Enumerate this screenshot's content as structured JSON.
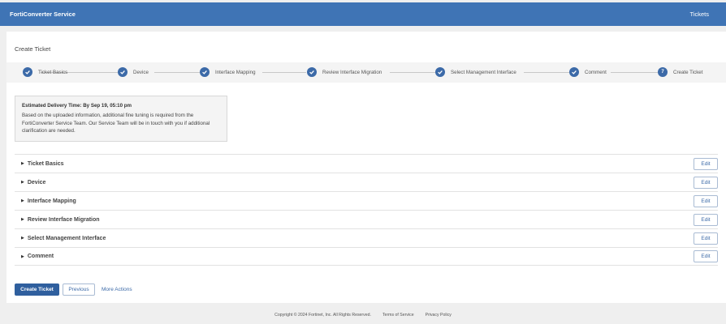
{
  "header": {
    "app_title": "FortiConverter Service",
    "nav_tickets": "Tickets"
  },
  "page": {
    "title": "Create Ticket"
  },
  "stepper": {
    "steps": [
      {
        "label": "Ticket Basics",
        "state": "done"
      },
      {
        "label": "Device",
        "state": "done"
      },
      {
        "label": "Interface Mapping",
        "state": "done"
      },
      {
        "label": "Review Interface Migration",
        "state": "done"
      },
      {
        "label": "Select Management Interface",
        "state": "done"
      },
      {
        "label": "Comment",
        "state": "done"
      },
      {
        "label": "Create Ticket",
        "state": "current",
        "number": "7"
      }
    ]
  },
  "info": {
    "title": "Estimated Delivery Time: By Sep 19, 05:10 pm",
    "line1": "Based on the uploaded information, additional fine tuning is required from the",
    "line2": "FortiConverter Service Team. Our Service Team will be in touch with you if additional",
    "line3": "clarification are needed."
  },
  "sections": [
    {
      "label": "Ticket Basics",
      "edit": "Edit"
    },
    {
      "label": "Device",
      "edit": "Edit"
    },
    {
      "label": "Interface Mapping",
      "edit": "Edit"
    },
    {
      "label": "Review Interface Migration",
      "edit": "Edit"
    },
    {
      "label": "Select Management Interface",
      "edit": "Edit"
    },
    {
      "label": "Comment",
      "edit": "Edit"
    }
  ],
  "actions": {
    "create_ticket": "Create Ticket",
    "previous": "Previous",
    "more_actions": "More Actions"
  },
  "footer": {
    "copyright": "Copyright © 2024 Fortinet, Inc. All Rights Reserved.",
    "terms": "Terms of Service",
    "privacy": "Privacy Policy"
  },
  "colors": {
    "header_bg": "#3f74b5",
    "step_circle": "#3c6aa8",
    "primary_button": "#2f5f9e"
  }
}
